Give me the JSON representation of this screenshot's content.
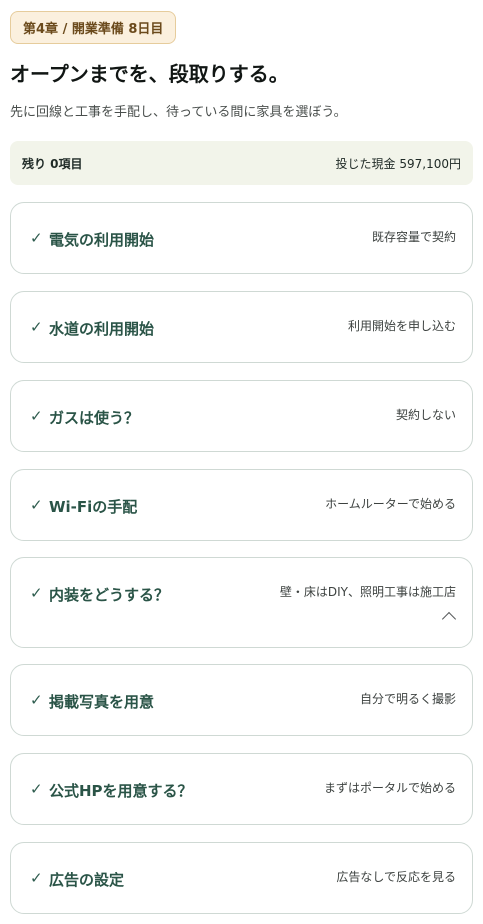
{
  "header": {
    "chapter_badge": "第4章 / 開業準備 8日目",
    "title": "オープンまでを、段取りする。",
    "subtitle": "先に回線と工事を手配し、待っている間に家具を選ぼう。"
  },
  "summary": {
    "remaining": "残り 0項目",
    "cash_spent": "投じた現金 597,100円"
  },
  "tasks": [
    {
      "check": "✓",
      "title": "電気の利用開始",
      "status": "既存容量で契約"
    },
    {
      "check": "✓",
      "title": "水道の利用開始",
      "status": "利用開始を申し込む"
    },
    {
      "check": "✓",
      "title": "ガスは使う？",
      "status": "契約しない"
    },
    {
      "check": "✓",
      "title": "Wi-Fiの手配",
      "status": "ホームルーターで始める"
    },
    {
      "check": "✓",
      "title": "内装をどうする？",
      "status": "壁・床はDIY、照明工事は施工店",
      "expanded": true
    },
    {
      "check": "✓",
      "title": "掲載写真を用意",
      "status": "自分で明るく撮影"
    },
    {
      "check": "✓",
      "title": "公式HPを用意する？",
      "status": "まずはポータルで始める"
    },
    {
      "check": "✓",
      "title": "広告の設定",
      "status": "広告なしで反応を見る"
    }
  ]
}
